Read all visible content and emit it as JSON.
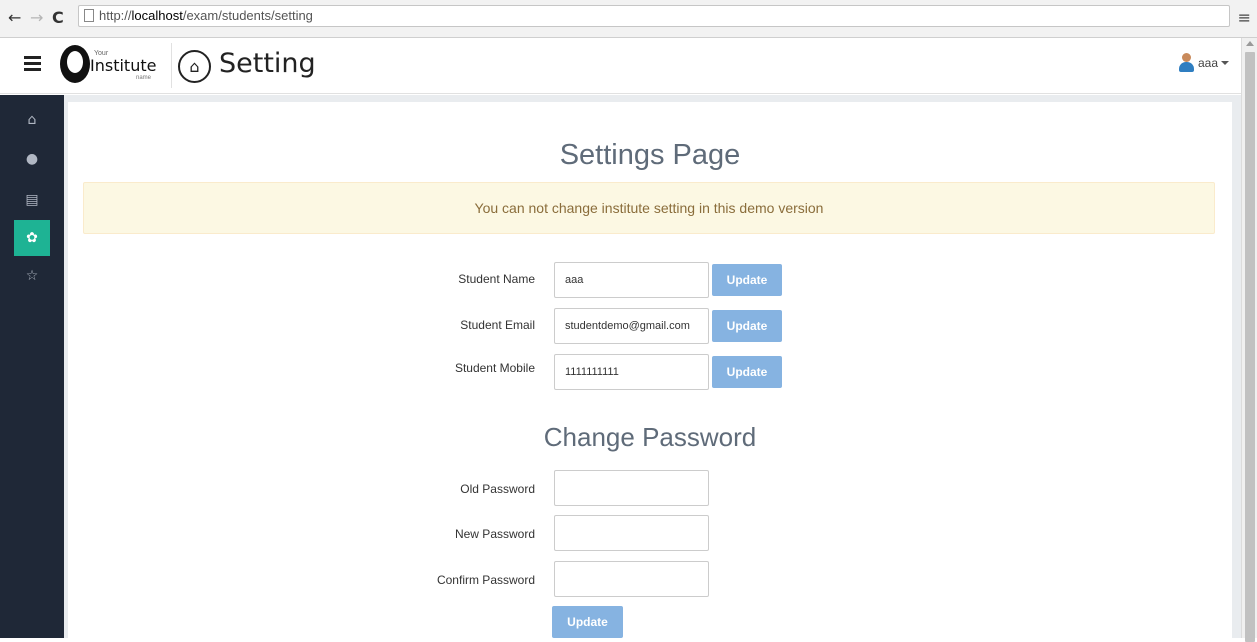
{
  "browser": {
    "back_glyph": "←",
    "forward_glyph": "→",
    "reload_glyph": "C",
    "url_scheme": "http://",
    "url_host": "localhost",
    "url_path": "/exam/students/setting",
    "menu_glyph": "≡"
  },
  "header": {
    "logo_your": "Your",
    "logo_name": "Institute",
    "logo_sub": "name",
    "home_glyph": "⌂",
    "title": "Setting",
    "user_name": "aaa"
  },
  "sidebar": {
    "items": [
      {
        "icon": "home-icon",
        "glyph": "⌂",
        "active": false
      },
      {
        "icon": "user-icon",
        "glyph": "●",
        "active": false
      },
      {
        "icon": "list-icon",
        "glyph": "▤",
        "active": false
      },
      {
        "icon": "gear-icon",
        "glyph": "✿",
        "active": true
      },
      {
        "icon": "star-icon",
        "glyph": "☆",
        "active": false
      }
    ],
    "active_color": "#1eb394"
  },
  "main": {
    "heading": "Settings Page",
    "alert": "You can not change institute setting in this demo version",
    "profile": [
      {
        "label": "Student Name",
        "value": "aaa",
        "button": "Update"
      },
      {
        "label": "Student Email",
        "value": "studentdemo@gmail.com",
        "button": "Update"
      },
      {
        "label": "Student Mobile",
        "value": "1111111111",
        "button": "Update"
      }
    ],
    "password_heading": "Change Password",
    "password_fields": [
      {
        "label": "Old Password",
        "value": ""
      },
      {
        "label": "New Password",
        "value": ""
      },
      {
        "label": "Confirm Password",
        "value": ""
      }
    ],
    "password_button": "Update"
  },
  "colors": {
    "sidebar_bg": "#1f2837",
    "button": "#86b3e1",
    "alert_bg": "#fcf8e3",
    "alert_text": "#8a6d3b"
  }
}
